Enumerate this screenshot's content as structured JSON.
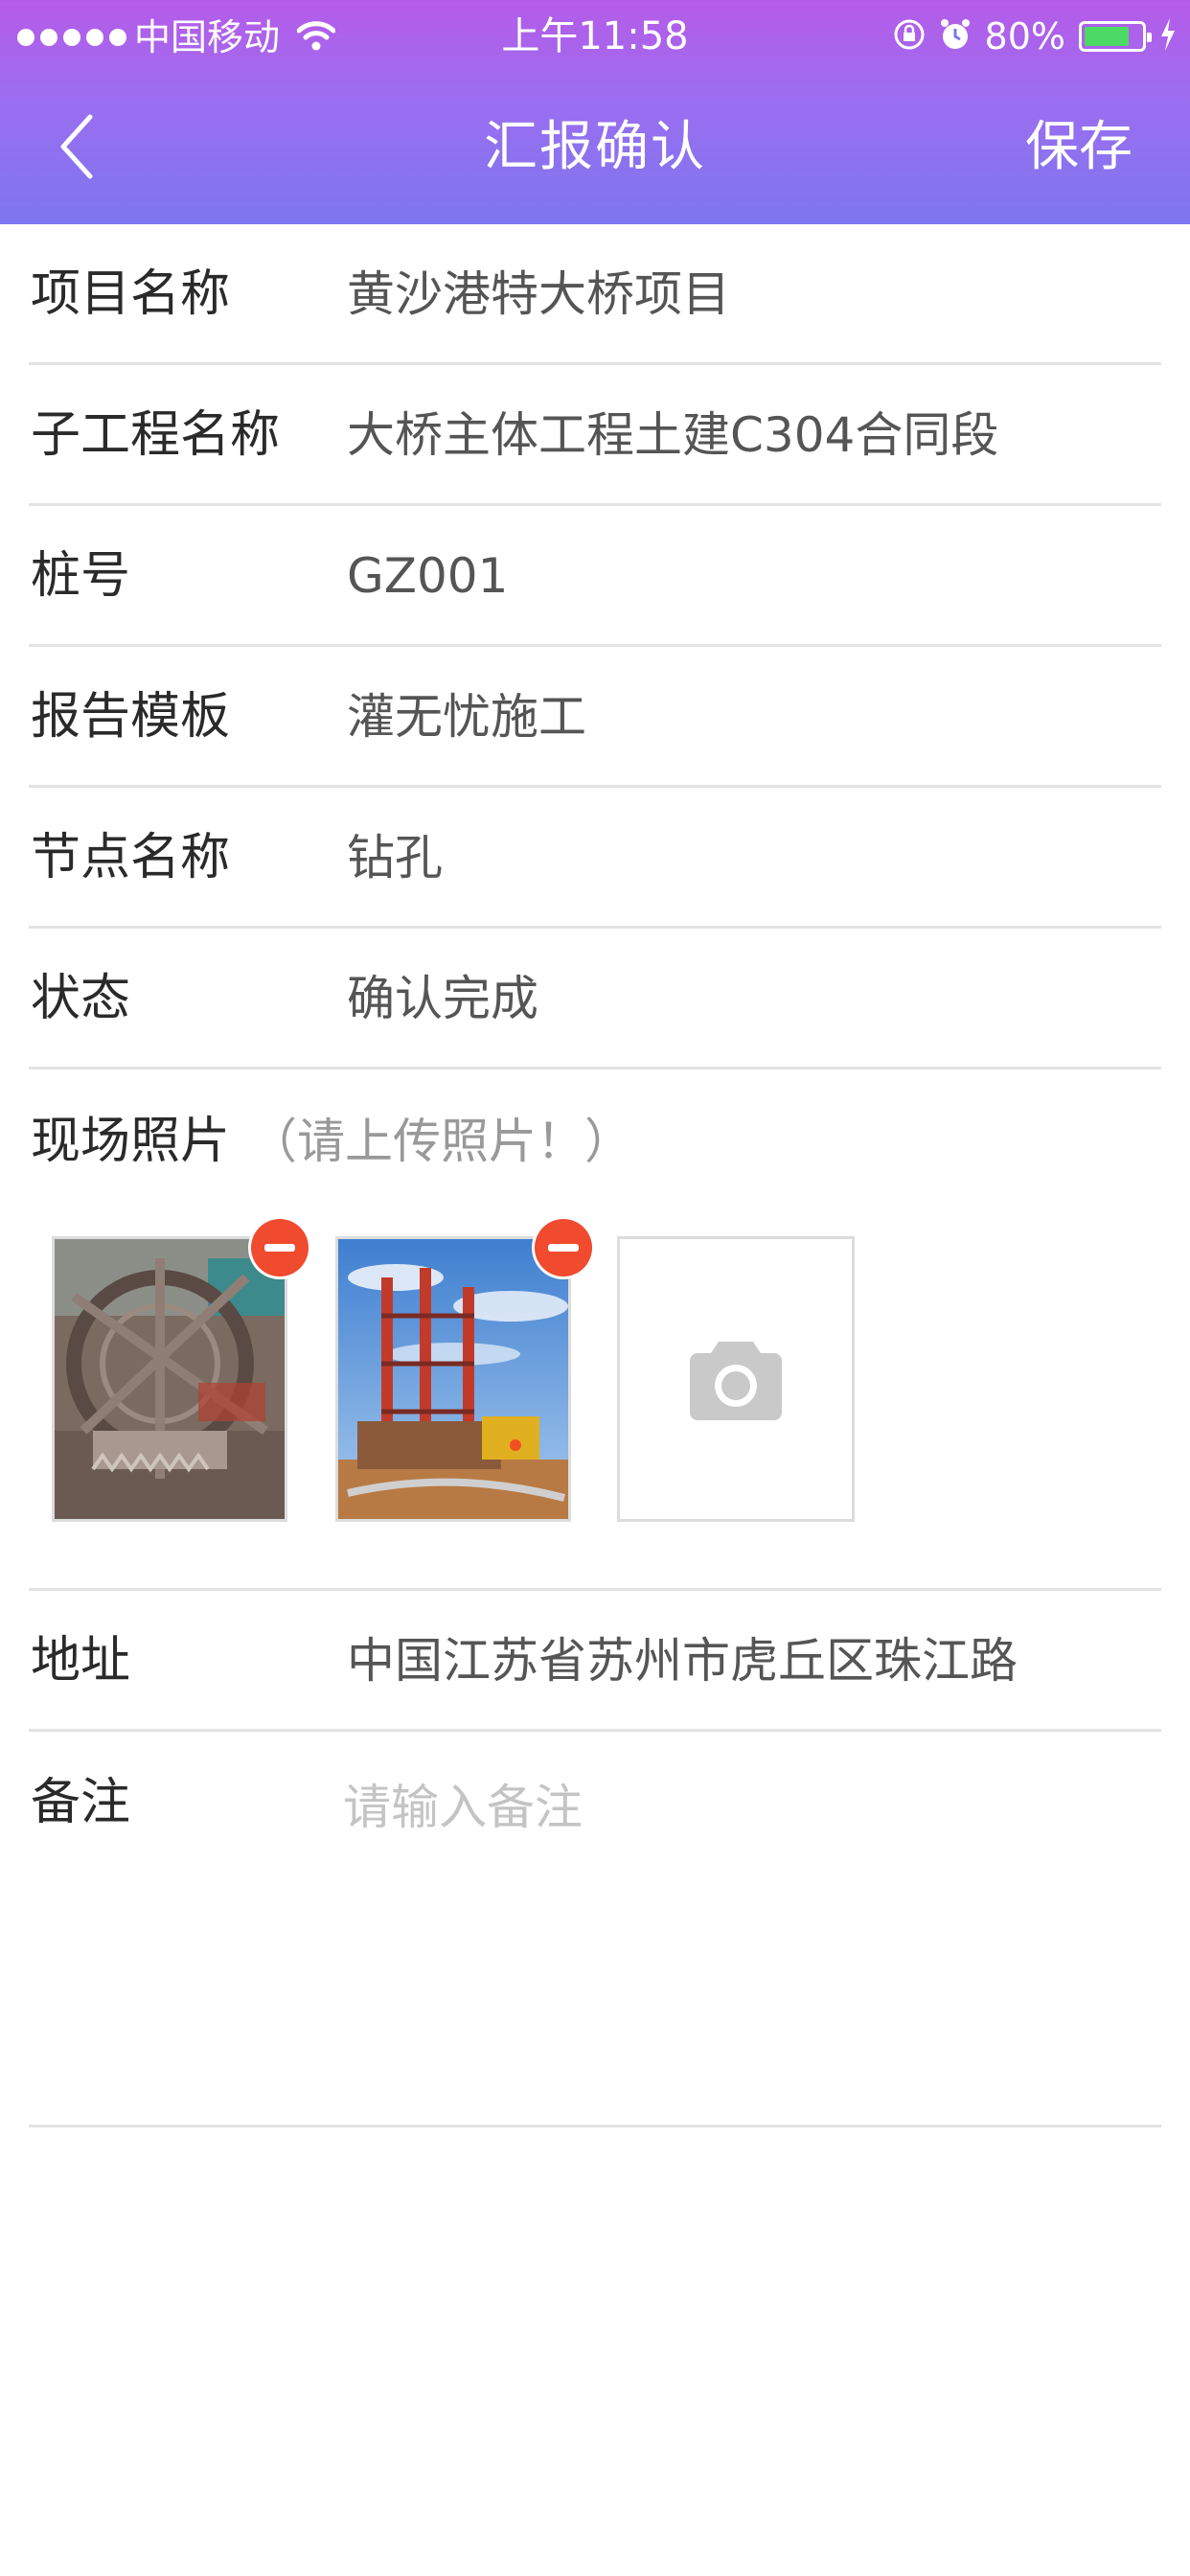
{
  "status_bar": {
    "carrier": "中国移动",
    "time": "上午11:58",
    "battery_pct": "80%",
    "battery_level": 0.8
  },
  "nav": {
    "title": "汇报确认",
    "save_label": "保存",
    "back_icon": "chevron-left-icon"
  },
  "fields": [
    {
      "label": "项目名称",
      "value": "黄沙港特大桥项目"
    },
    {
      "label": "子工程名称",
      "value": "大桥主体工程土建C304合同段"
    },
    {
      "label": "桩号",
      "value": "GZ001"
    },
    {
      "label": "报告模板",
      "value": "灌无忧施工"
    },
    {
      "label": "节点名称",
      "value": "钻孔"
    },
    {
      "label": "状态",
      "value": "确认完成"
    }
  ],
  "photos": {
    "label": "现场照片",
    "hint": "（请上传照片！）",
    "add_icon": "camera-icon",
    "remove_icon": "minus-circle-icon"
  },
  "address": {
    "label": "地址",
    "value": "中国江苏省苏州市虎丘区珠江路"
  },
  "remark": {
    "label": "备注",
    "placeholder": "请输入备注",
    "value": ""
  },
  "colors": {
    "header_gradient_top": "#b65be8",
    "header_gradient_bottom": "#7d76ee",
    "remove_badge": "#f04a2f",
    "divider": "#e3e3e3"
  }
}
